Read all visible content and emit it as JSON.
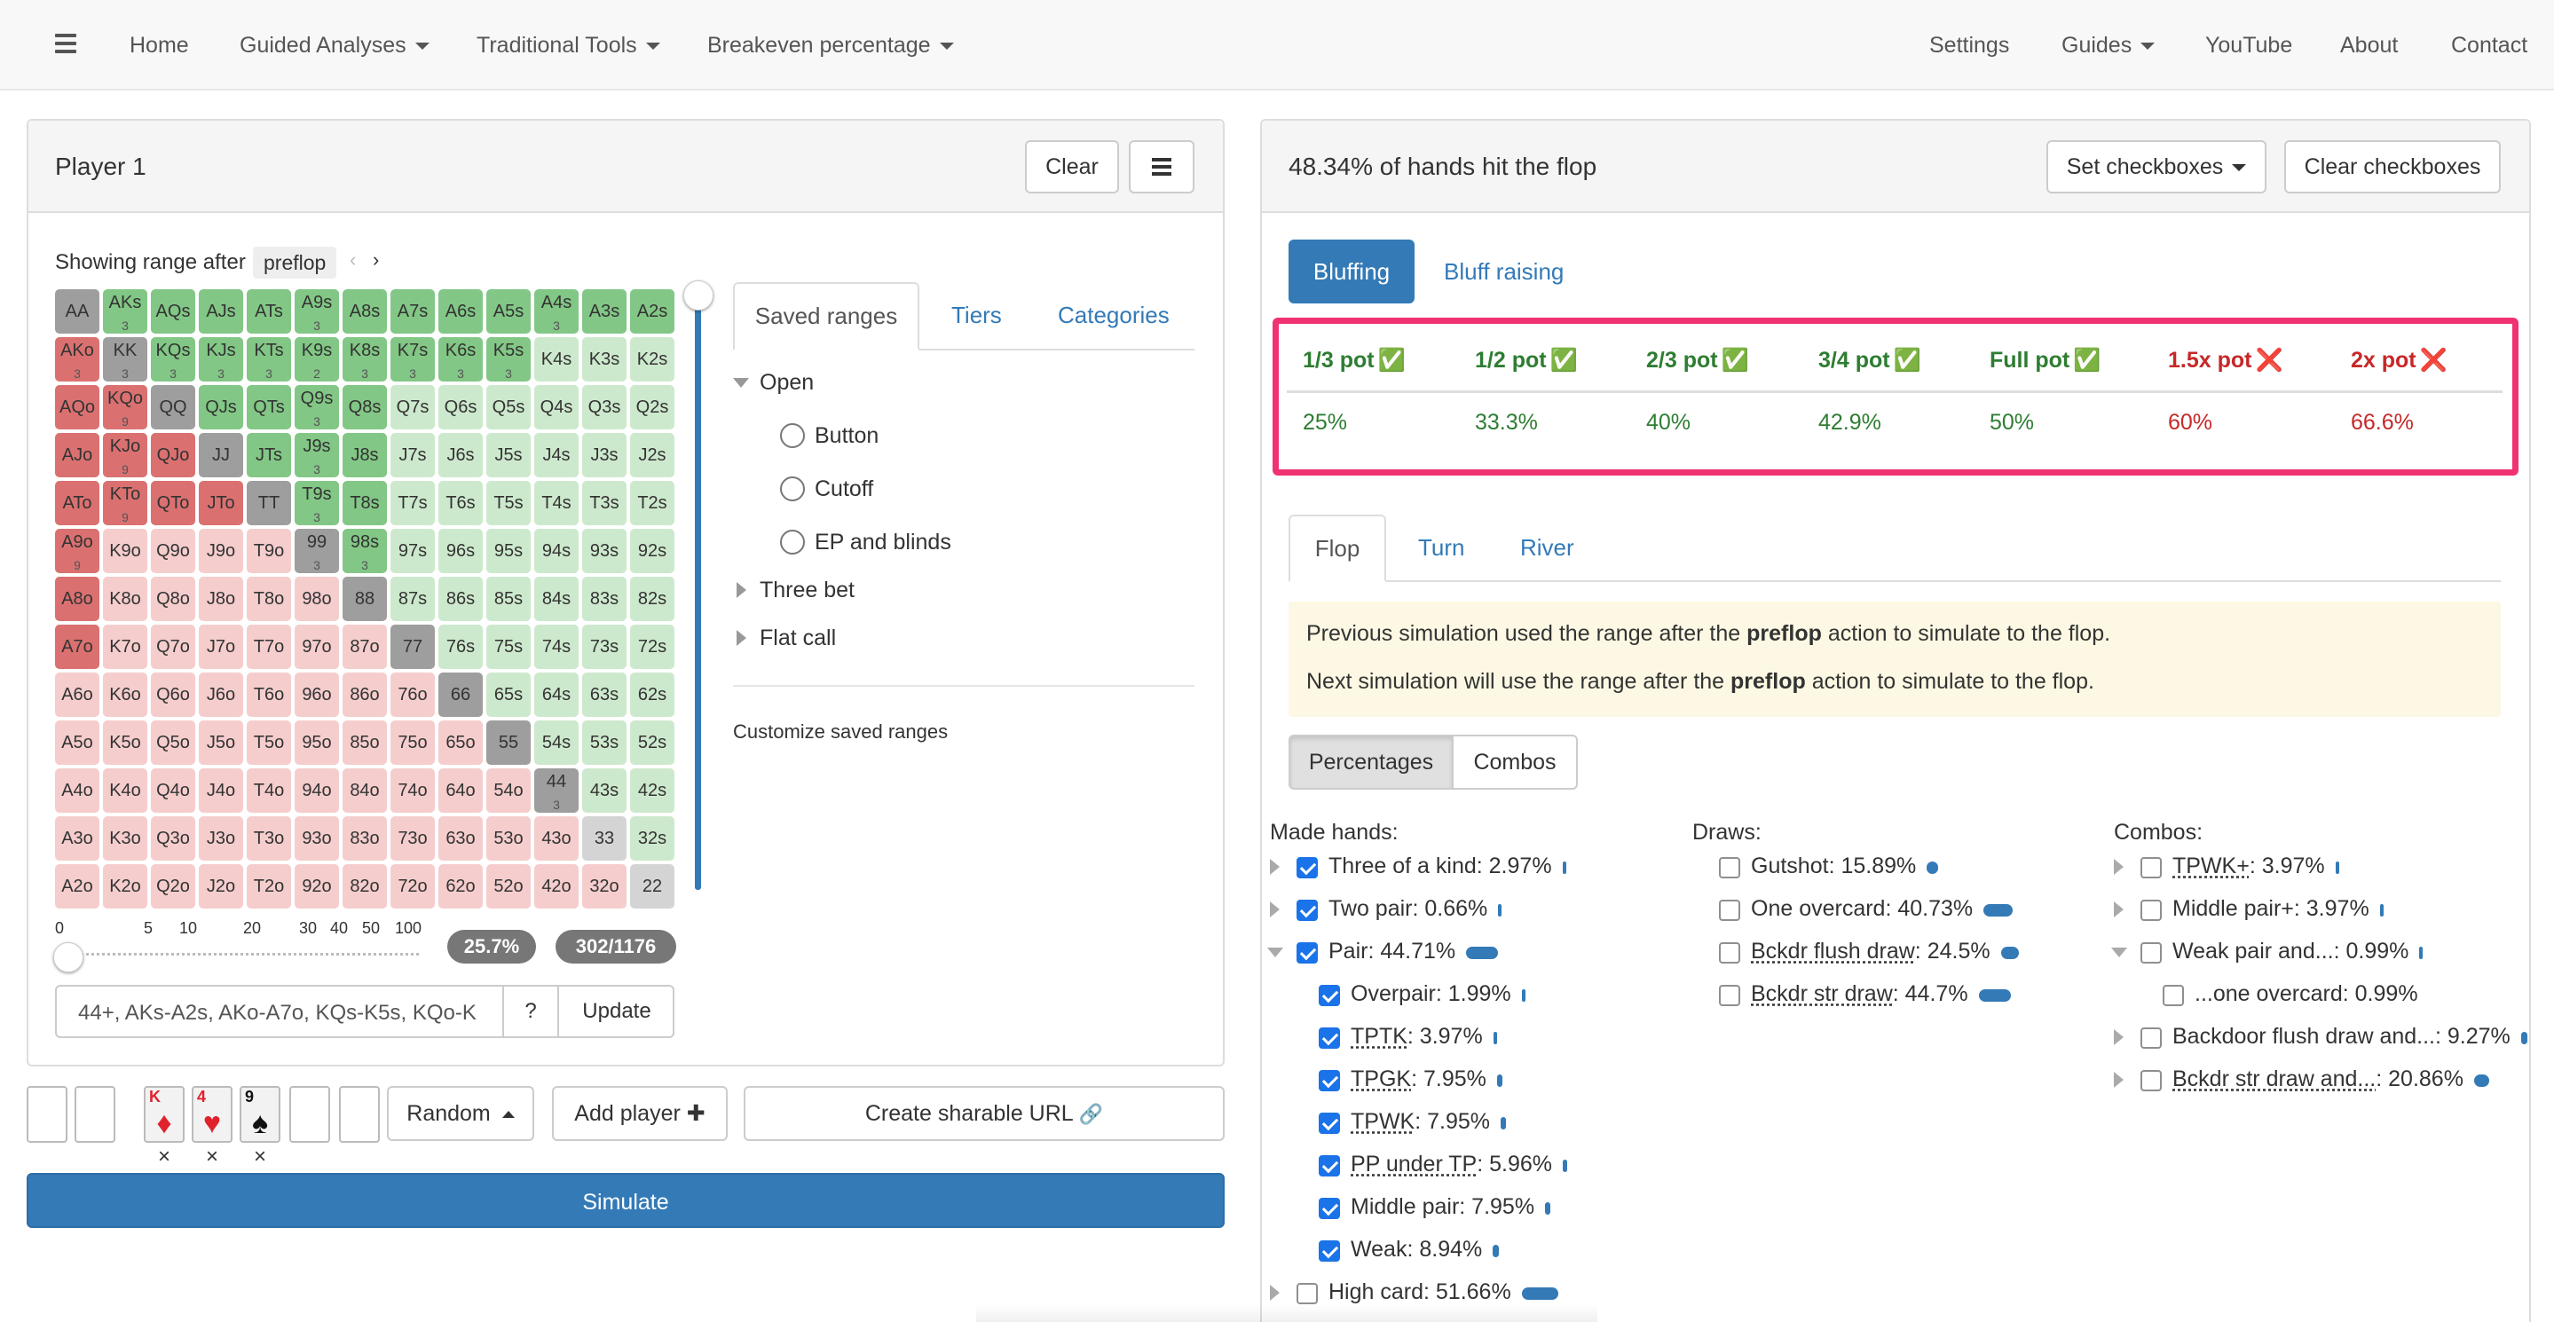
{
  "nav": {
    "home": "Home",
    "guided": "Guided Analyses",
    "traditional": "Traditional Tools",
    "breakeven": "Breakeven percentage",
    "settings": "Settings",
    "guides": "Guides",
    "youtube": "YouTube",
    "about": "About",
    "contact": "Contact"
  },
  "player": {
    "title": "Player 1",
    "clear": "Clear",
    "showing_prefix": "Showing range after",
    "street": "preflop",
    "range_pct": "25.7%",
    "combos": "302/1176",
    "range_text": "44+, AKs-A2s, AKo-A7o, KQs-K5s, KQo-K",
    "help": "?",
    "update": "Update",
    "slider_ticks": [
      "0",
      "5",
      "10",
      "20",
      "30",
      "40",
      "50",
      "100"
    ],
    "grid": [
      [
        [
          "AA",
          "g"
        ],
        [
          "AKs",
          "G",
          "3"
        ],
        [
          "AQs",
          "G"
        ],
        [
          "AJs",
          "G"
        ],
        [
          "ATs",
          "G"
        ],
        [
          "A9s",
          "G",
          "3"
        ],
        [
          "A8s",
          "G"
        ],
        [
          "A7s",
          "G"
        ],
        [
          "A6s",
          "G"
        ],
        [
          "A5s",
          "G"
        ],
        [
          "A4s",
          "G",
          "3"
        ],
        [
          "A3s",
          "G"
        ],
        [
          "A2s",
          "G"
        ]
      ],
      [
        [
          "AKo",
          "R",
          "3"
        ],
        [
          "KK",
          "g",
          "3"
        ],
        [
          "KQs",
          "G",
          "3"
        ],
        [
          "KJs",
          "G",
          "3"
        ],
        [
          "KTs",
          "G",
          "3"
        ],
        [
          "K9s",
          "G",
          "2"
        ],
        [
          "K8s",
          "G",
          "3"
        ],
        [
          "K7s",
          "G",
          "3"
        ],
        [
          "K6s",
          "G",
          "3"
        ],
        [
          "K5s",
          "G",
          "3"
        ],
        [
          "K4s",
          "L"
        ],
        [
          "K3s",
          "L"
        ],
        [
          "K2s",
          "L"
        ]
      ],
      [
        [
          "AQo",
          "R"
        ],
        [
          "KQo",
          "R",
          "9"
        ],
        [
          "QQ",
          "g"
        ],
        [
          "QJs",
          "G"
        ],
        [
          "QTs",
          "G"
        ],
        [
          "Q9s",
          "G",
          "3"
        ],
        [
          "Q8s",
          "G"
        ],
        [
          "Q7s",
          "L"
        ],
        [
          "Q6s",
          "L"
        ],
        [
          "Q5s",
          "L"
        ],
        [
          "Q4s",
          "L"
        ],
        [
          "Q3s",
          "L"
        ],
        [
          "Q2s",
          "L"
        ]
      ],
      [
        [
          "AJo",
          "R"
        ],
        [
          "KJo",
          "R",
          "9"
        ],
        [
          "QJo",
          "R"
        ],
        [
          "JJ",
          "g"
        ],
        [
          "JTs",
          "G"
        ],
        [
          "J9s",
          "G",
          "3"
        ],
        [
          "J8s",
          "G"
        ],
        [
          "J7s",
          "L"
        ],
        [
          "J6s",
          "L"
        ],
        [
          "J5s",
          "L"
        ],
        [
          "J4s",
          "L"
        ],
        [
          "J3s",
          "L"
        ],
        [
          "J2s",
          "L"
        ]
      ],
      [
        [
          "ATo",
          "R"
        ],
        [
          "KTo",
          "R",
          "9"
        ],
        [
          "QTo",
          "R"
        ],
        [
          "JTo",
          "R"
        ],
        [
          "TT",
          "g"
        ],
        [
          "T9s",
          "G",
          "3"
        ],
        [
          "T8s",
          "G"
        ],
        [
          "T7s",
          "L"
        ],
        [
          "T6s",
          "L"
        ],
        [
          "T5s",
          "L"
        ],
        [
          "T4s",
          "L"
        ],
        [
          "T3s",
          "L"
        ],
        [
          "T2s",
          "L"
        ]
      ],
      [
        [
          "A9o",
          "R",
          "9"
        ],
        [
          "K9o",
          "P"
        ],
        [
          "Q9o",
          "P"
        ],
        [
          "J9o",
          "P"
        ],
        [
          "T9o",
          "P"
        ],
        [
          "99",
          "g",
          "3"
        ],
        [
          "98s",
          "G",
          "3"
        ],
        [
          "97s",
          "L"
        ],
        [
          "96s",
          "L"
        ],
        [
          "95s",
          "L"
        ],
        [
          "94s",
          "L"
        ],
        [
          "93s",
          "L"
        ],
        [
          "92s",
          "L"
        ]
      ],
      [
        [
          "A8o",
          "R"
        ],
        [
          "K8o",
          "P"
        ],
        [
          "Q8o",
          "P"
        ],
        [
          "J8o",
          "P"
        ],
        [
          "T8o",
          "P"
        ],
        [
          "98o",
          "P"
        ],
        [
          "88",
          "g"
        ],
        [
          "87s",
          "L"
        ],
        [
          "86s",
          "L"
        ],
        [
          "85s",
          "L"
        ],
        [
          "84s",
          "L"
        ],
        [
          "83s",
          "L"
        ],
        [
          "82s",
          "L"
        ]
      ],
      [
        [
          "A7o",
          "R"
        ],
        [
          "K7o",
          "P"
        ],
        [
          "Q7o",
          "P"
        ],
        [
          "J7o",
          "P"
        ],
        [
          "T7o",
          "P"
        ],
        [
          "97o",
          "P"
        ],
        [
          "87o",
          "P"
        ],
        [
          "77",
          "g"
        ],
        [
          "76s",
          "L"
        ],
        [
          "75s",
          "L"
        ],
        [
          "74s",
          "L"
        ],
        [
          "73s",
          "L"
        ],
        [
          "72s",
          "L"
        ]
      ],
      [
        [
          "A6o",
          "P"
        ],
        [
          "K6o",
          "P"
        ],
        [
          "Q6o",
          "P"
        ],
        [
          "J6o",
          "P"
        ],
        [
          "T6o",
          "P"
        ],
        [
          "96o",
          "P"
        ],
        [
          "86o",
          "P"
        ],
        [
          "76o",
          "P"
        ],
        [
          "66",
          "g"
        ],
        [
          "65s",
          "L"
        ],
        [
          "64s",
          "L"
        ],
        [
          "63s",
          "L"
        ],
        [
          "62s",
          "L"
        ]
      ],
      [
        [
          "A5o",
          "P"
        ],
        [
          "K5o",
          "P"
        ],
        [
          "Q5o",
          "P"
        ],
        [
          "J5o",
          "P"
        ],
        [
          "T5o",
          "P"
        ],
        [
          "95o",
          "P"
        ],
        [
          "85o",
          "P"
        ],
        [
          "75o",
          "P"
        ],
        [
          "65o",
          "P"
        ],
        [
          "55",
          "g"
        ],
        [
          "54s",
          "L"
        ],
        [
          "53s",
          "L"
        ],
        [
          "52s",
          "L"
        ]
      ],
      [
        [
          "A4o",
          "P"
        ],
        [
          "K4o",
          "P"
        ],
        [
          "Q4o",
          "P"
        ],
        [
          "J4o",
          "P"
        ],
        [
          "T4o",
          "P"
        ],
        [
          "94o",
          "P"
        ],
        [
          "84o",
          "P"
        ],
        [
          "74o",
          "P"
        ],
        [
          "64o",
          "P"
        ],
        [
          "54o",
          "P"
        ],
        [
          "44",
          "g",
          "3"
        ],
        [
          "43s",
          "L"
        ],
        [
          "42s",
          "L"
        ]
      ],
      [
        [
          "A3o",
          "P"
        ],
        [
          "K3o",
          "P"
        ],
        [
          "Q3o",
          "P"
        ],
        [
          "J3o",
          "P"
        ],
        [
          "T3o",
          "P"
        ],
        [
          "93o",
          "P"
        ],
        [
          "83o",
          "P"
        ],
        [
          "73o",
          "P"
        ],
        [
          "63o",
          "P"
        ],
        [
          "53o",
          "P"
        ],
        [
          "43o",
          "P"
        ],
        [
          "33",
          "q"
        ],
        [
          "32s",
          "L"
        ]
      ],
      [
        [
          "A2o",
          "P"
        ],
        [
          "K2o",
          "P"
        ],
        [
          "Q2o",
          "P"
        ],
        [
          "J2o",
          "P"
        ],
        [
          "T2o",
          "P"
        ],
        [
          "92o",
          "P"
        ],
        [
          "82o",
          "P"
        ],
        [
          "72o",
          "P"
        ],
        [
          "62o",
          "P"
        ],
        [
          "52o",
          "P"
        ],
        [
          "42o",
          "P"
        ],
        [
          "32o",
          "P"
        ],
        [
          "22",
          "q"
        ]
      ]
    ]
  },
  "saved": {
    "tabs": [
      "Saved ranges",
      "Tiers",
      "Categories"
    ],
    "open": "Open",
    "options": [
      "Button",
      "Cutoff",
      "EP and blinds"
    ],
    "three_bet": "Three bet",
    "flat_call": "Flat call",
    "customize": "Customize saved ranges"
  },
  "board": {
    "cards": [
      {
        "rank": "K",
        "suit": "♦",
        "color": "#e0222d"
      },
      {
        "rank": "4",
        "suit": "♥",
        "color": "#e0222d"
      },
      {
        "rank": "9",
        "suit": "♠",
        "color": "#111111"
      }
    ],
    "x": "×",
    "random": "Random",
    "add_player": "Add player",
    "plus": "✚",
    "share": "Create sharable URL",
    "link_icon": "🔗",
    "simulate": "Simulate"
  },
  "results": {
    "title": "48.34% of hands hit the flop",
    "set_checkboxes": "Set checkboxes",
    "clear_checkboxes": "Clear checkboxes",
    "bluff_tabs": [
      "Bluffing",
      "Bluff raising"
    ],
    "pots": [
      {
        "label": "1/3 pot",
        "mark": "✅",
        "value": "25%",
        "ok": true
      },
      {
        "label": "1/2 pot",
        "mark": "✅",
        "value": "33.3%",
        "ok": true
      },
      {
        "label": "2/3 pot",
        "mark": "✅",
        "value": "40%",
        "ok": true
      },
      {
        "label": "3/4 pot",
        "mark": "✅",
        "value": "42.9%",
        "ok": true
      },
      {
        "label": "Full pot",
        "mark": "✅",
        "value": "50%",
        "ok": true
      },
      {
        "label": "1.5x pot",
        "mark": "❌",
        "value": "60%",
        "ok": false
      },
      {
        "label": "2x pot",
        "mark": "❌",
        "value": "66.6%",
        "ok": false
      }
    ],
    "street_tabs": [
      "Flop",
      "Turn",
      "River"
    ],
    "info1_pre": "Previous simulation used the range after the",
    "info1_bold": "preflop",
    "info1_post": "action to simulate to the flop.",
    "info2_pre": "Next simulation will use the range after the",
    "info2_bold": "preflop",
    "info2_post": "action to simulate to the flop.",
    "view_tabs": [
      "Percentages",
      "Combos"
    ],
    "made_title": "Made hands:",
    "draws_title": "Draws:",
    "combos_title": "Combos:",
    "made": [
      {
        "text": "Three of a kind: 2.97%",
        "checked": true,
        "bar": 0.03
      },
      {
        "text": "Two pair: 0.66%",
        "checked": true,
        "bar": 0.007
      },
      {
        "text": "Pair: 44.71%",
        "checked": true,
        "bar": 0.447
      },
      {
        "text": "Overpair: 1.99%",
        "checked": true,
        "bar": 0.02
      },
      {
        "text": "TPTK: 3.97%",
        "checked": true,
        "bar": 0.04
      },
      {
        "text": "TPGK: 7.95%",
        "checked": true,
        "bar": 0.08
      },
      {
        "text": "TPWK: 7.95%",
        "checked": true,
        "bar": 0.08
      },
      {
        "text": "PP under TP: 5.96%",
        "checked": true,
        "bar": 0.06
      },
      {
        "text": "Middle pair: 7.95%",
        "checked": true,
        "bar": 0.08
      },
      {
        "text": "Weak: 8.94%",
        "checked": true,
        "bar": 0.09
      },
      {
        "text": "High card: 51.66%",
        "checked": false,
        "bar": 0.517
      }
    ],
    "draws": [
      {
        "text": "Gutshot: 15.89%",
        "checked": false,
        "bar": 0.159
      },
      {
        "text": "One overcard: 40.73%",
        "checked": false,
        "bar": 0.407
      },
      {
        "text": "Bckdr flush draw: 24.5%",
        "checked": false,
        "bar": 0.245
      },
      {
        "text": "Bckdr str draw: 44.7%",
        "checked": false,
        "bar": 0.447
      }
    ],
    "combos": [
      {
        "text": "TPWK+: 3.97%",
        "checked": false,
        "bar": 0.04
      },
      {
        "text": "Middle pair+: 3.97%",
        "checked": false,
        "bar": 0.04
      },
      {
        "text": "Weak pair and...: 0.99%",
        "checked": false,
        "bar": 0.01
      },
      {
        "text": "...one overcard: 0.99%",
        "checked": false,
        "bar": 0
      },
      {
        "text": "Backdoor flush draw and...: 9.27%",
        "checked": false,
        "bar": 0.093
      },
      {
        "text": "Bckdr str draw and...: 20.86%",
        "checked": false,
        "bar": 0.209
      }
    ]
  },
  "colors": {
    "G": "#82c785",
    "L": "#cde9cd",
    "R": "#da7170",
    "P": "#f5cdcd",
    "g": "#9e9e9e",
    "q": "#d4d4d4",
    "primary": "#337ab7",
    "ok": "#2e7d32",
    "bad": "#c62828",
    "highlight": "#f03273"
  }
}
